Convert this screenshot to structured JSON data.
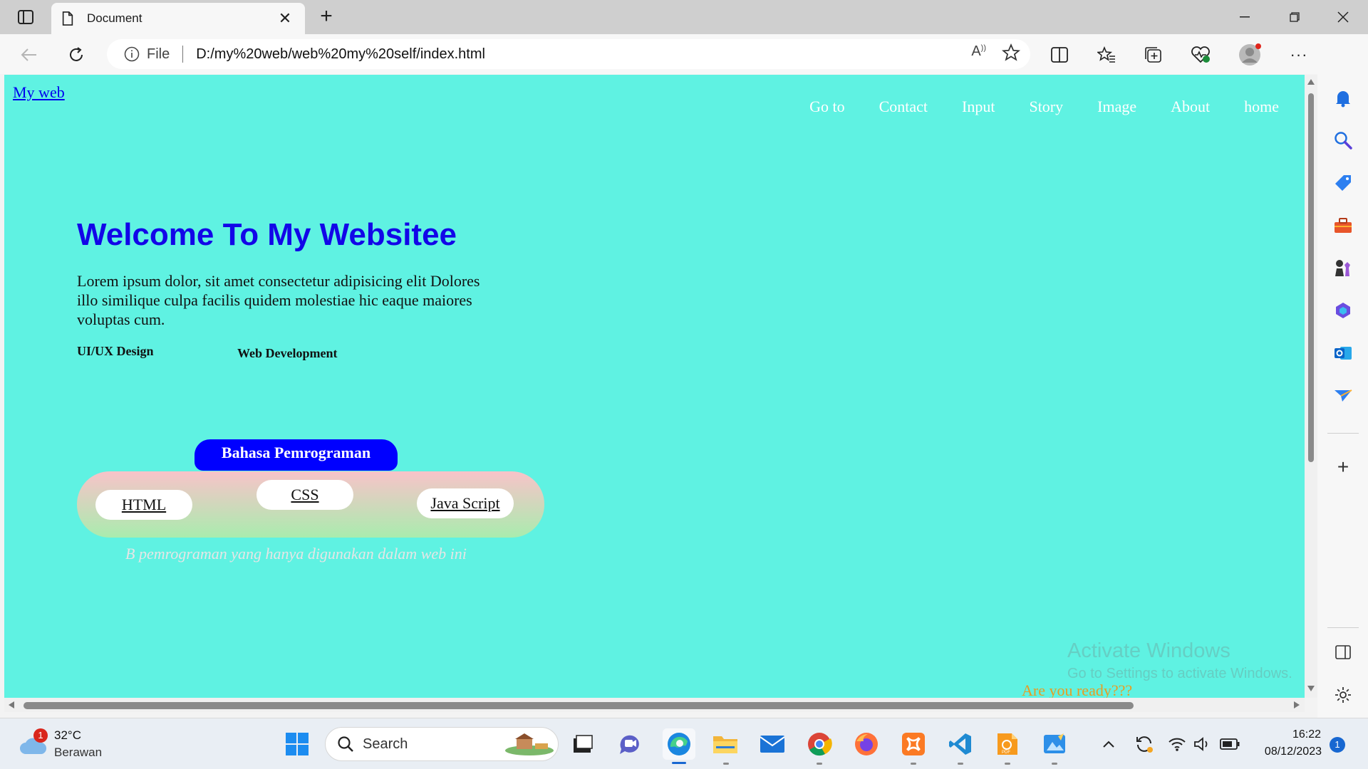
{
  "browser": {
    "tab_title": "Document",
    "address_scheme": "File",
    "url": "D:/my%20web/web%20my%20self/index.html"
  },
  "page": {
    "brand": "My web",
    "nav": [
      "Go to",
      "Contact",
      "Input",
      "Story",
      "Image",
      "About",
      "home"
    ],
    "hero_title": "Welcome To My Websitee",
    "hero_text": "Lorem ipsum dolor, sit amet consectetur adipisicing elit Dolores illo similique culpa facilis quidem molestiae hic eaque maiores voluptas cum.",
    "skills": [
      "UI/UX Design",
      "Web Development"
    ],
    "lang_title": "Bahasa Pemrograman",
    "languages": [
      "HTML",
      "CSS",
      "Java Script"
    ],
    "caption": "B pemrograman yang hanya digunakan dalam web ini",
    "cta_text": "Are you ready???",
    "bg_color": "#5ff2e2"
  },
  "watermark": {
    "line1": "Activate Windows",
    "line2": "Go to Settings to activate Windows."
  },
  "taskbar": {
    "weather_temp": "32°C",
    "weather_desc": "Berawan",
    "weather_badge": "1",
    "search_label": "Search",
    "time": "16:22",
    "date": "08/12/2023",
    "notification_count": "1"
  }
}
